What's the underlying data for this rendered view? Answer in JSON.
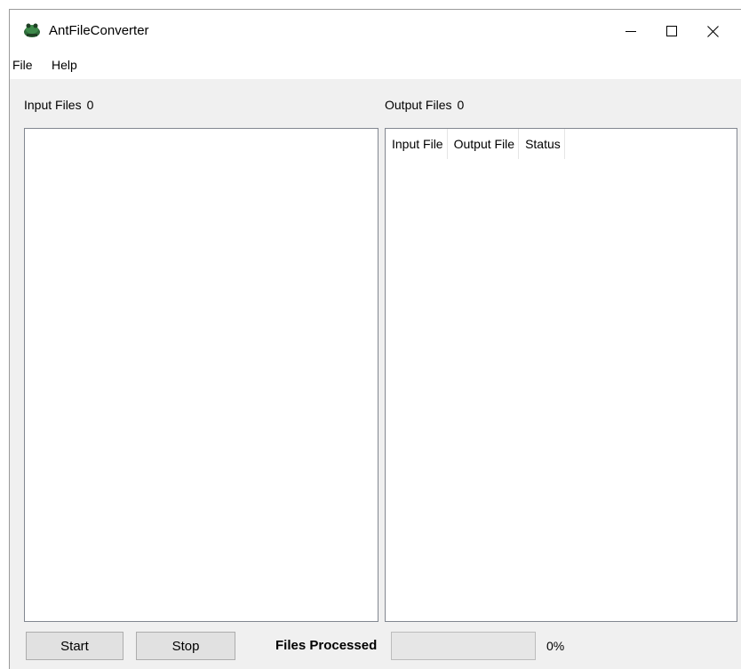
{
  "window": {
    "title": "AntFileConverter",
    "app_icon": "ant-app-icon",
    "controls": {
      "minimize_icon": "minimize-icon",
      "maximize_icon": "maximize-icon",
      "close_icon": "close-icon"
    }
  },
  "menu": {
    "items": [
      {
        "label": "File"
      },
      {
        "label": "Help"
      }
    ]
  },
  "input_panel": {
    "label": "Input Files",
    "count": "0",
    "items": []
  },
  "output_panel": {
    "label": "Output Files",
    "count": "0",
    "columns": [
      "Input File",
      "Output File",
      "Status"
    ],
    "rows": []
  },
  "footer": {
    "start_label": "Start",
    "stop_label": "Stop",
    "files_processed_label": "Files Processed",
    "progress_fraction": 0,
    "percent_text": "0%"
  },
  "colors": {
    "window_bg": "#f0f0f0",
    "panel_bg": "#ffffff",
    "panel_border": "#828790",
    "button_bg": "#e1e1e1",
    "progress_fill": "#06b025"
  }
}
